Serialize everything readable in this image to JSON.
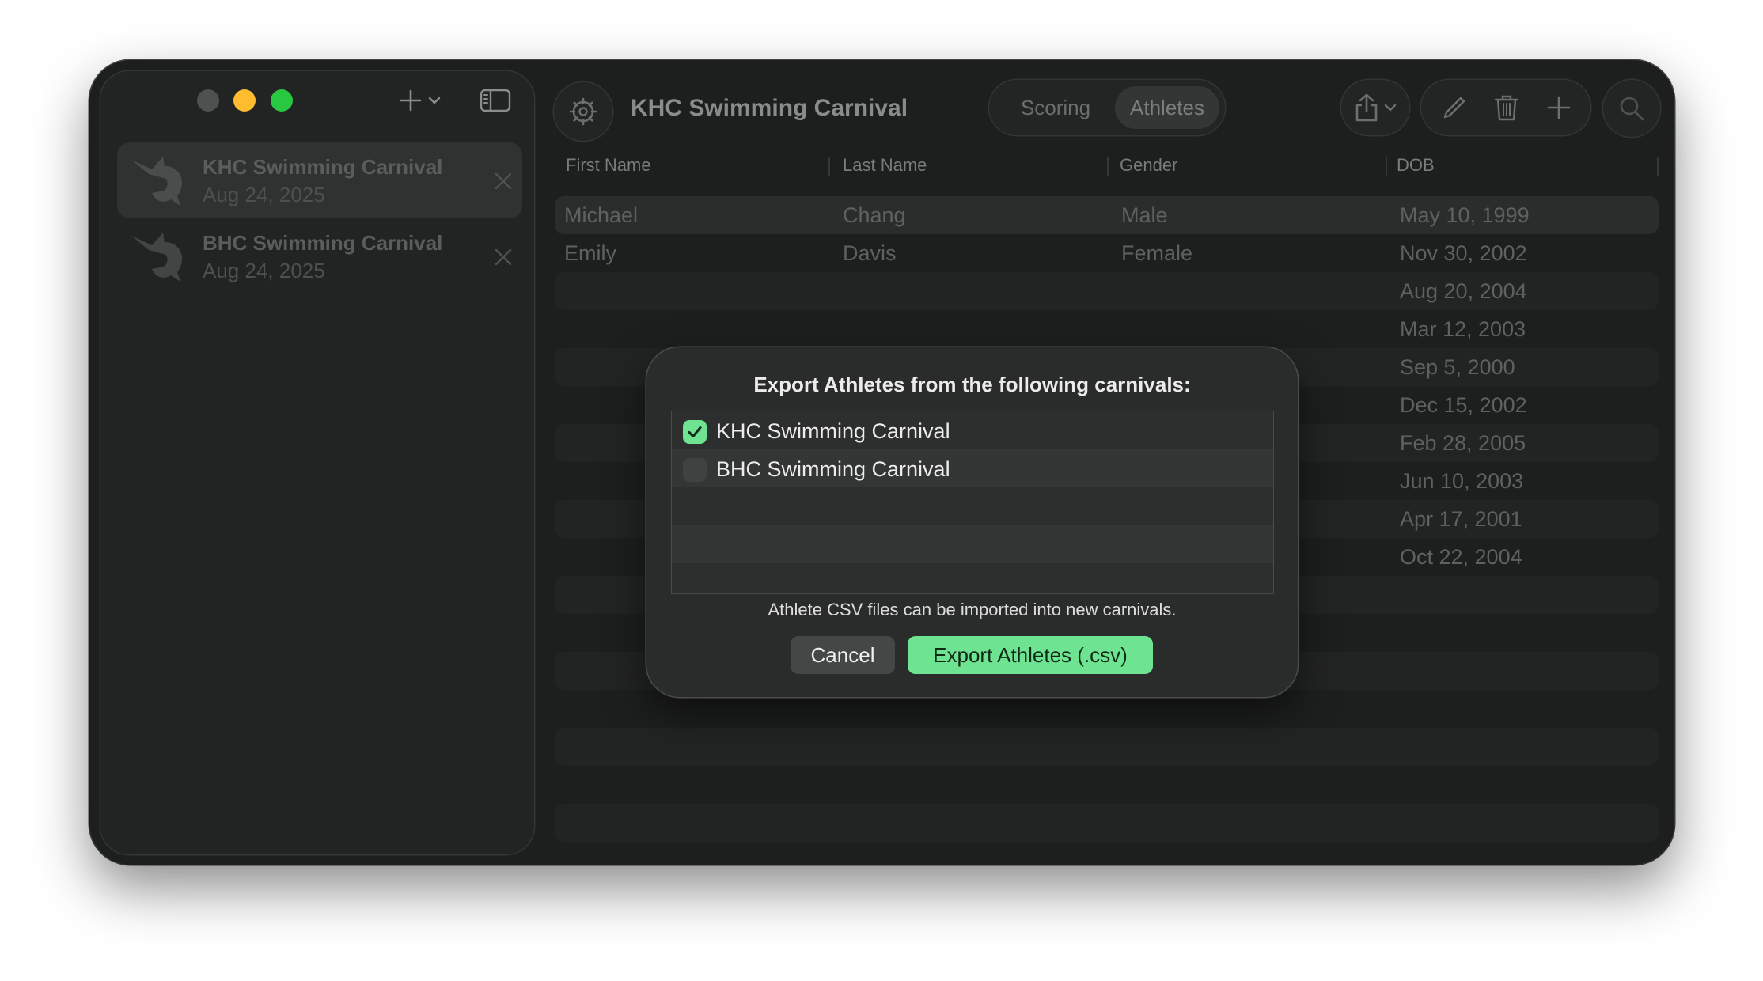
{
  "window": {
    "title": "KHC Swimming Carnival"
  },
  "segments": [
    {
      "label": "Scoring",
      "selected": false
    },
    {
      "label": "Athletes",
      "selected": true
    }
  ],
  "sidebar": {
    "items": [
      {
        "name": "KHC Swimming Carnival",
        "date": "Aug 24, 2025",
        "selected": true
      },
      {
        "name": "BHC Swimming Carnival",
        "date": "Aug 24, 2025",
        "selected": false
      }
    ]
  },
  "table": {
    "headers": [
      "First Name",
      "Last Name",
      "Gender",
      "DOB"
    ],
    "rows": [
      [
        "Michael",
        "Chang",
        "Male",
        "May 10, 1999"
      ],
      [
        "Emily",
        "Davis",
        "Female",
        "Nov 30, 2002"
      ],
      [
        "",
        "",
        "",
        "Aug 20, 2004"
      ],
      [
        "",
        "",
        "",
        "Mar 12, 2003"
      ],
      [
        "",
        "",
        "",
        "Sep 5, 2000"
      ],
      [
        "",
        "",
        "",
        "Dec 15, 2002"
      ],
      [
        "",
        "",
        "",
        "Feb 28, 2005"
      ],
      [
        "",
        "",
        "",
        "Jun 10, 2003"
      ],
      [
        "",
        "",
        "",
        "Apr 17, 2001"
      ],
      [
        "",
        "",
        "",
        "Oct 22, 2004"
      ]
    ]
  },
  "dialog": {
    "title": "Export Athletes from the following carnivals:",
    "options": [
      {
        "label": "KHC Swimming Carnival",
        "checked": true
      },
      {
        "label": "BHC Swimming Carnival",
        "checked": false
      }
    ],
    "note": "Athlete CSV files can be imported into new carnivals.",
    "cancel_label": "Cancel",
    "export_label": "Export Athletes (.csv)"
  },
  "icons": {
    "settings": "gear-icon",
    "share": "share-icon",
    "edit": "pencil-icon",
    "delete": "trash-icon",
    "add": "plus-icon",
    "search": "magnifier-icon",
    "sidebar_toggle": "sidebar-toggle-icon",
    "carnival_logo": "marlin-icon"
  },
  "colors": {
    "accent": "#6ee492",
    "minimize": "#febc2e",
    "zoom": "#28c840"
  }
}
